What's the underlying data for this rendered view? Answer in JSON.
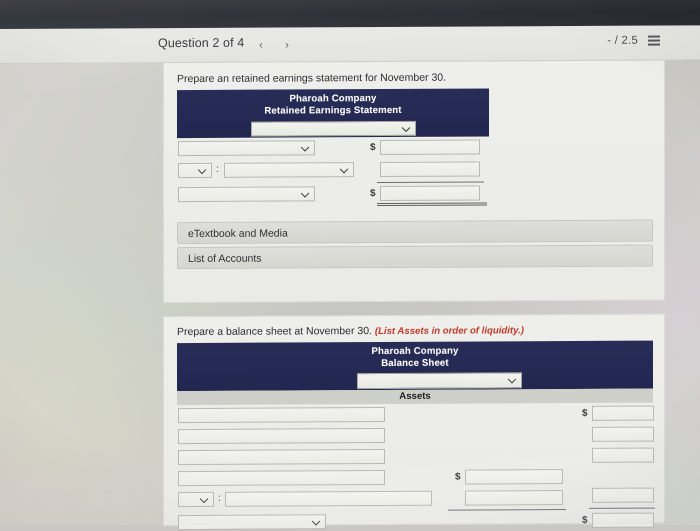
{
  "header": {
    "question_label": "Question 2 of 4",
    "prev_icon": "chevron-left-icon",
    "next_icon": "chevron-right-icon",
    "prev_glyph": "‹",
    "next_glyph": "›",
    "score": "- / 2.5",
    "menu_icon": "list-menu-icon"
  },
  "retained_earnings": {
    "prompt": "Prepare an retained earnings statement for November 30.",
    "company": "Pharoah Company",
    "statement_title": "Retained Earnings Statement",
    "period_select_value": "",
    "rows": [
      {
        "label_select_value": "",
        "has_dollar": true,
        "amount_value": ""
      },
      {
        "label_select_value": "",
        "has_dollar": false,
        "amount_value": "",
        "has_prefix_select": true,
        "prefix_select_value": "",
        "colon": ":"
      },
      {
        "label_select_value": "",
        "has_dollar": true,
        "amount_value": ""
      }
    ],
    "actions": [
      {
        "label": "eTextbook and Media"
      },
      {
        "label": "List of Accounts"
      }
    ]
  },
  "balance_sheet": {
    "prompt": "Prepare a balance sheet at November 30.",
    "prompt_note": "(List Assets in order of liquidity.)",
    "company": "Pharoah Company",
    "statement_title": "Balance Sheet",
    "date_select_value": "",
    "section_header": "Assets",
    "rows": [
      {
        "label_value": "",
        "mid_dollar": false,
        "mid_value": null,
        "right_dollar": true,
        "right_value": ""
      },
      {
        "label_value": "",
        "mid_dollar": false,
        "mid_value": null,
        "right_dollar": false,
        "right_value": ""
      },
      {
        "label_value": "",
        "mid_dollar": false,
        "mid_value": null,
        "right_dollar": false,
        "right_value": ""
      },
      {
        "label_value": "",
        "mid_dollar": true,
        "mid_value": "",
        "right_dollar": false,
        "right_value": null
      },
      {
        "prefix_select_value": "",
        "colon": ":",
        "label_value": "",
        "mid_dollar": false,
        "mid_value": "",
        "right_dollar": false,
        "right_value": ""
      },
      {
        "label_select_value": "",
        "mid_dollar": false,
        "mid_value": null,
        "right_dollar": true,
        "right_value": ""
      }
    ]
  },
  "colors": {
    "statement_header_navy": "#272d57",
    "prompt_red": "#c0392b",
    "card_bg": "#eeeeea",
    "page_bg": "#c9c8c4",
    "band_gray": "#cfcfca"
  }
}
